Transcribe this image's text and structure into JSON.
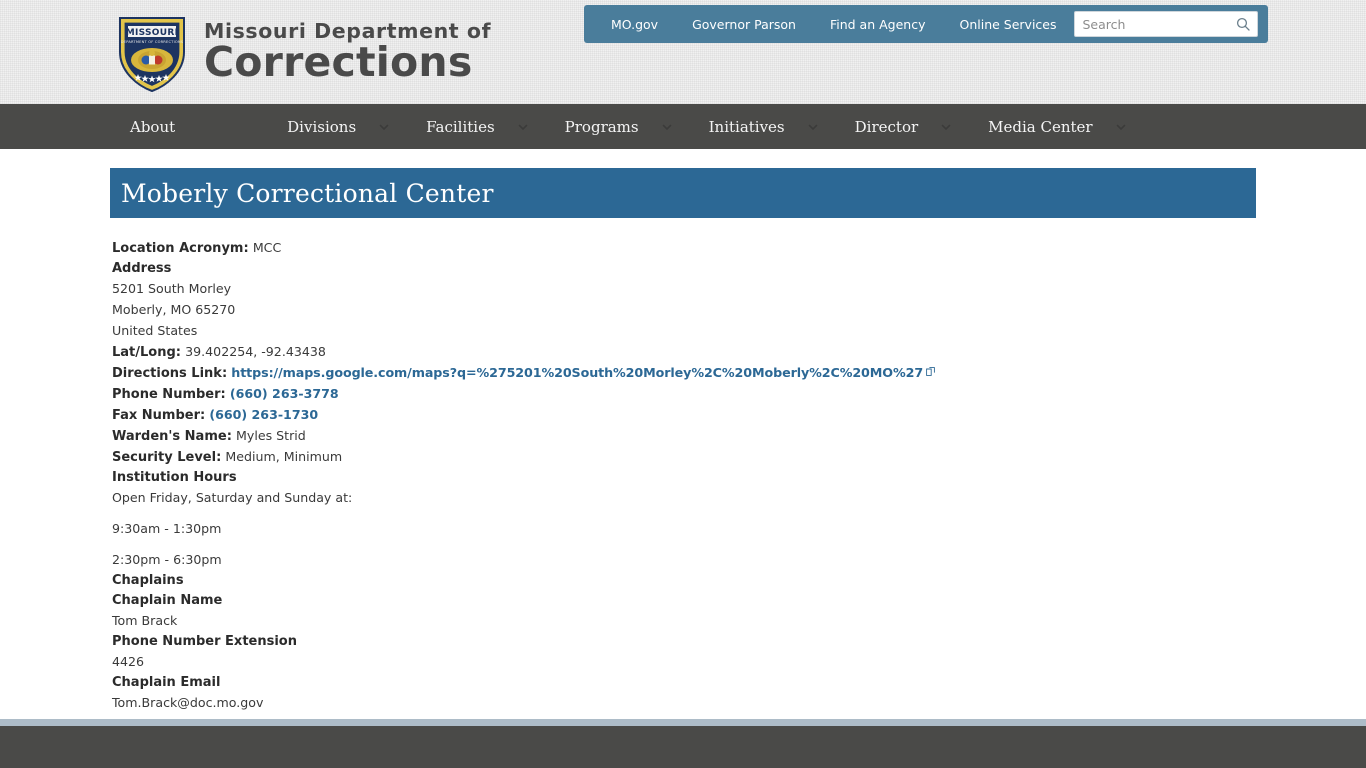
{
  "brand": {
    "line1": "Missouri Department of",
    "line2": "Corrections",
    "shield": {
      "top_text": "MISSOURI",
      "sub_text": "DEPARTMENT OF CORRECTIONS"
    }
  },
  "utility_nav": {
    "items": [
      {
        "label": "MO.gov"
      },
      {
        "label": "Governor Parson"
      },
      {
        "label": "Find an Agency"
      },
      {
        "label": "Online Services"
      }
    ]
  },
  "search": {
    "placeholder": "Search",
    "value": "",
    "icon": "search-icon"
  },
  "main_nav": {
    "items": [
      {
        "label": "About",
        "has_caret": false
      },
      {
        "label": "Divisions",
        "has_caret": true
      },
      {
        "label": "Facilities",
        "has_caret": true
      },
      {
        "label": "Programs",
        "has_caret": true
      },
      {
        "label": "Initiatives",
        "has_caret": true
      },
      {
        "label": "Director",
        "has_caret": true
      },
      {
        "label": "Media Center",
        "has_caret": true
      }
    ]
  },
  "page": {
    "title": "Moberly Correctional Center"
  },
  "details": {
    "location_acronym_label": "Location Acronym:",
    "location_acronym_value": "MCC",
    "address_label": "Address",
    "address_lines": [
      "5201 South Morley",
      "Moberly, MO 65270",
      "United States"
    ],
    "latlong_label": "Lat/Long:",
    "latlong_value": "39.402254, -92.43438",
    "directions_label": "Directions Link:",
    "directions_url": "https://maps.google.com/maps?q=%275201%20South%20Morley%2C%20Moberly%2C%20MO%27",
    "phone_label": "Phone Number:",
    "phone_value": "(660) 263-3778",
    "fax_label": "Fax Number:",
    "fax_value": "(660) 263-1730",
    "warden_label": "Warden's Name:",
    "warden_value": "Myles Strid",
    "security_label": "Security Level:",
    "security_value": "Medium, Minimum",
    "hours_label": "Institution Hours",
    "hours_intro": "Open Friday, Saturday and Sunday at:",
    "hours_slot_1": "9:30am - 1:30pm",
    "hours_slot_2": "2:30pm - 6:30pm",
    "chaplains_label": "Chaplains",
    "chaplain_name_label": "Chaplain Name",
    "chaplain_name_value": "Tom Brack",
    "chaplain_ext_label": "Phone Number Extension",
    "chaplain_ext_value": "4426",
    "chaplain_email_label": "Chaplain Email",
    "chaplain_email_value": "Tom.Brack@doc.mo.gov"
  },
  "colors": {
    "utility_bar": "#4a7d9b",
    "nav_bar": "#4a4a48",
    "banner": "#2c6895",
    "link": "#2c6895",
    "footer": "#4a4a48",
    "footer_divider": "#adbcc8",
    "header_bg": "#f1f1f1"
  }
}
